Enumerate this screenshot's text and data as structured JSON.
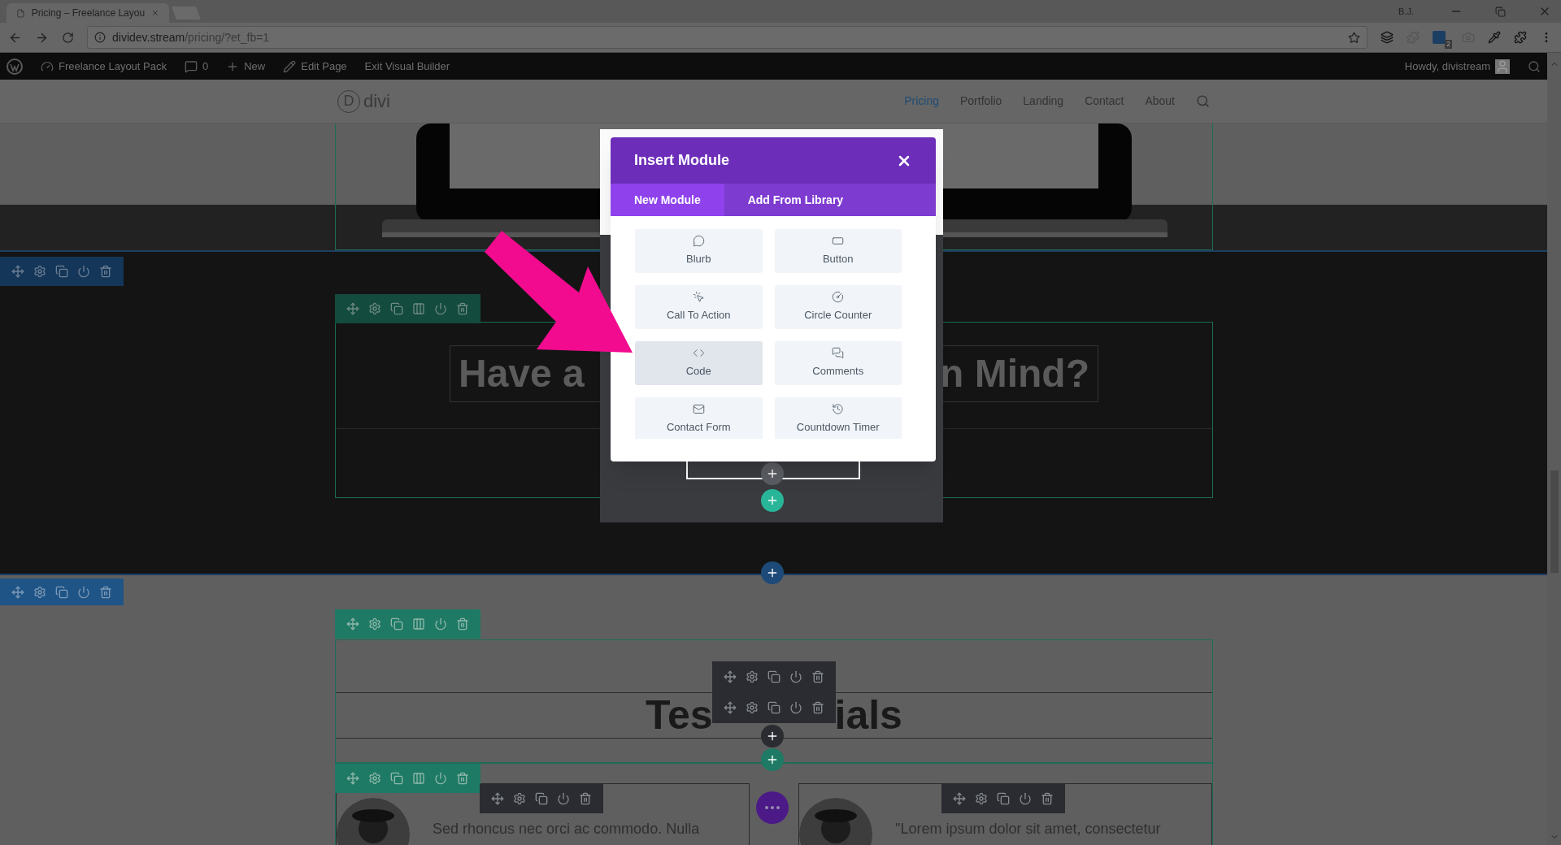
{
  "browser": {
    "tab_title": "Pricing – Freelance Layou",
    "profile": "B.J.",
    "url_host": "dividev.stream",
    "url_path": "/pricing/?et_fb=1",
    "extension_badge": "2"
  },
  "admin_bar": {
    "items": [
      {
        "kind": "wordpress"
      },
      {
        "kind": "dashboard",
        "label": "Freelance Layout Pack"
      },
      {
        "kind": "comments",
        "label": "0"
      },
      {
        "kind": "new",
        "label": "New"
      },
      {
        "kind": "edit",
        "label": "Edit Page"
      },
      {
        "kind": "plain",
        "label": "Exit Visual Builder"
      }
    ],
    "greeting": "Howdy, divistream"
  },
  "site_header": {
    "logo_mark": "D",
    "logo": "divi",
    "nav": [
      {
        "label": "Pricing",
        "selected": true
      },
      {
        "label": "Portfolio",
        "selected": false
      },
      {
        "label": "Landing",
        "selected": false
      },
      {
        "label": "Contact",
        "selected": false
      },
      {
        "label": "About",
        "selected": false
      }
    ]
  },
  "call_section": {
    "heading_left": "Have a",
    "heading_right": "n Mind?"
  },
  "modal": {
    "title": "Insert Module",
    "tabs": [
      {
        "label": "New Module",
        "selected": true
      },
      {
        "label": "Add From Library",
        "selected": false
      }
    ],
    "modules": [
      {
        "kind": "blurb",
        "label": "Blurb",
        "selected": false
      },
      {
        "kind": "button",
        "label": "Button",
        "selected": false
      },
      {
        "kind": "cta",
        "label": "Call To Action",
        "selected": false
      },
      {
        "kind": "counter",
        "label": "Circle Counter",
        "selected": false
      },
      {
        "kind": "code",
        "label": "Code",
        "selected": true
      },
      {
        "kind": "comments",
        "label": "Comments",
        "selected": false
      },
      {
        "kind": "mail",
        "label": "Contact Form",
        "selected": false
      },
      {
        "kind": "timer",
        "label": "Countdown Timer",
        "selected": false
      }
    ]
  },
  "testimonials": {
    "heading_left": "Tes",
    "heading_right": "ials",
    "quotes": [
      "Sed rhoncus nec orci ac commodo. Nulla",
      "\"Lorem ipsum dolor sit amet, consectetur"
    ]
  }
}
